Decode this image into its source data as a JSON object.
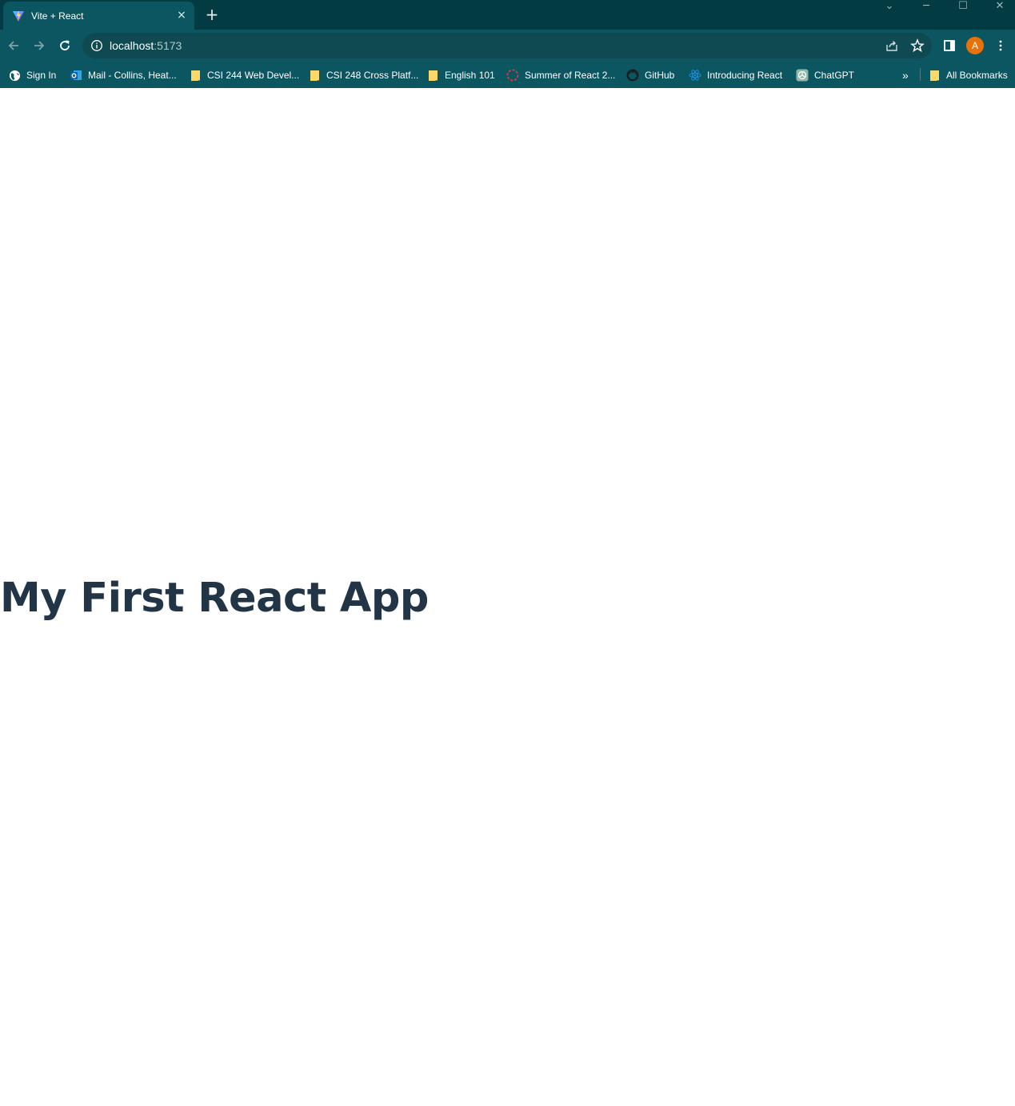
{
  "browser": {
    "tab": {
      "title": "Vite + React",
      "close_glyph": "×",
      "favicon": "vite-logo-icon"
    },
    "new_tab_glyph": "+",
    "window_controls": {
      "tab_search": "⌄",
      "minimize": "─",
      "maximize": "☐",
      "close": "✕"
    },
    "address": {
      "host": "localhost",
      "port": ":5173"
    },
    "profile_initial": "A",
    "colors": {
      "tabstrip": "#033b43",
      "toolbar": "#0b5660",
      "omnibox": "#0f4a52",
      "avatar": "#e8710a"
    }
  },
  "bookmarks": {
    "items": [
      {
        "label": "Sign In",
        "icon": "globe-icon"
      },
      {
        "label": "Mail - Collins, Heat...",
        "icon": "outlook-icon"
      },
      {
        "label": "CSI 244 Web Devel...",
        "icon": "bookmark-folder-icon"
      },
      {
        "label": "CSI 248 Cross Platf...",
        "icon": "bookmark-folder-icon"
      },
      {
        "label": "English 101",
        "icon": "bookmark-folder-icon"
      },
      {
        "label": "Summer of React 2...",
        "icon": "circle-dashed-icon"
      },
      {
        "label": "GitHub",
        "icon": "github-icon"
      },
      {
        "label": "Introducing React",
        "icon": "react-icon"
      },
      {
        "label": "ChatGPT",
        "icon": "chatgpt-icon"
      }
    ],
    "overflow_glyph": "»",
    "all_bookmarks": "All Bookmarks"
  },
  "page": {
    "heading": "My First React App",
    "heading_color": "#213547"
  }
}
